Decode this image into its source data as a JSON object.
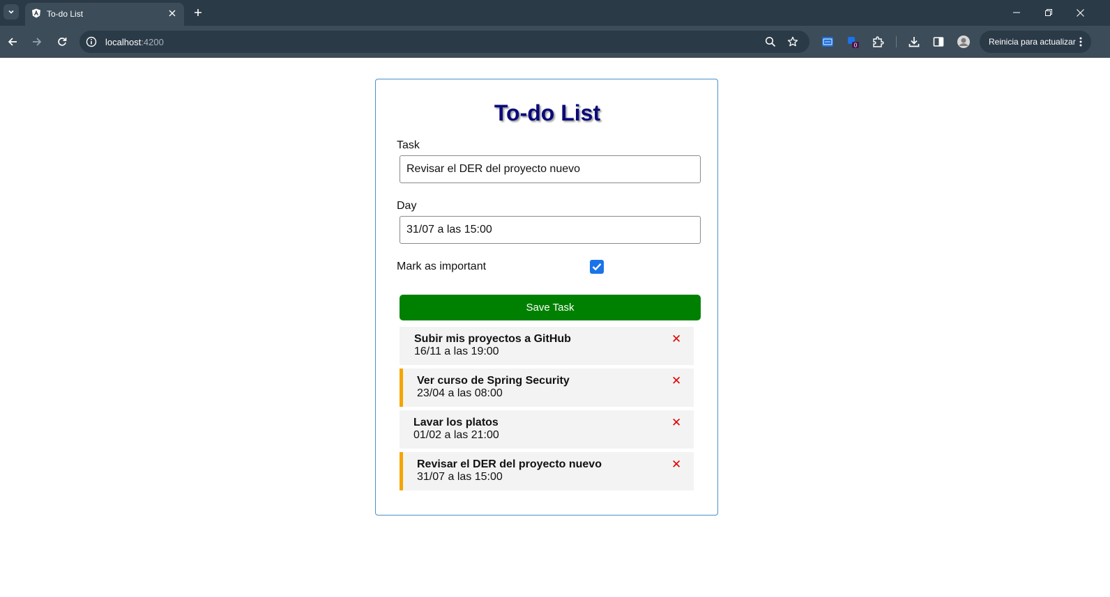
{
  "browser": {
    "tab": {
      "title": "To-do List",
      "favicon": "angular-icon"
    },
    "url": {
      "host": "localhost",
      "port": ":4200"
    },
    "update_button": {
      "label": "Reinicia para actualizar"
    },
    "extension_badge": "0"
  },
  "app": {
    "title": "To-do List",
    "task_label": "Task",
    "task_value": "Revisar el DER del proyecto nuevo",
    "day_label": "Day",
    "day_value": "31/07 a las 15:00",
    "important_label": "Mark as important",
    "important_checked": true,
    "save_label": "Save Task",
    "delete_symbol": "✕",
    "tasks": [
      {
        "text": "Subir mis proyectos a GitHub",
        "day": "16/11 a las 19:00",
        "reminder": false
      },
      {
        "text": "Ver curso de Spring Security",
        "day": "23/04 a las 08:00",
        "reminder": true
      },
      {
        "text": "Lavar los platos",
        "day": "01/02 a las 21:00",
        "reminder": false
      },
      {
        "text": "Revisar el DER del proyecto nuevo",
        "day": "31/07 a las 15:00",
        "reminder": true
      }
    ]
  },
  "colors": {
    "title": "#0a0a7a",
    "save_button": "#008000",
    "important_border": "#f5a500",
    "delete": "#e00000",
    "card_border": "#4a90c8"
  }
}
